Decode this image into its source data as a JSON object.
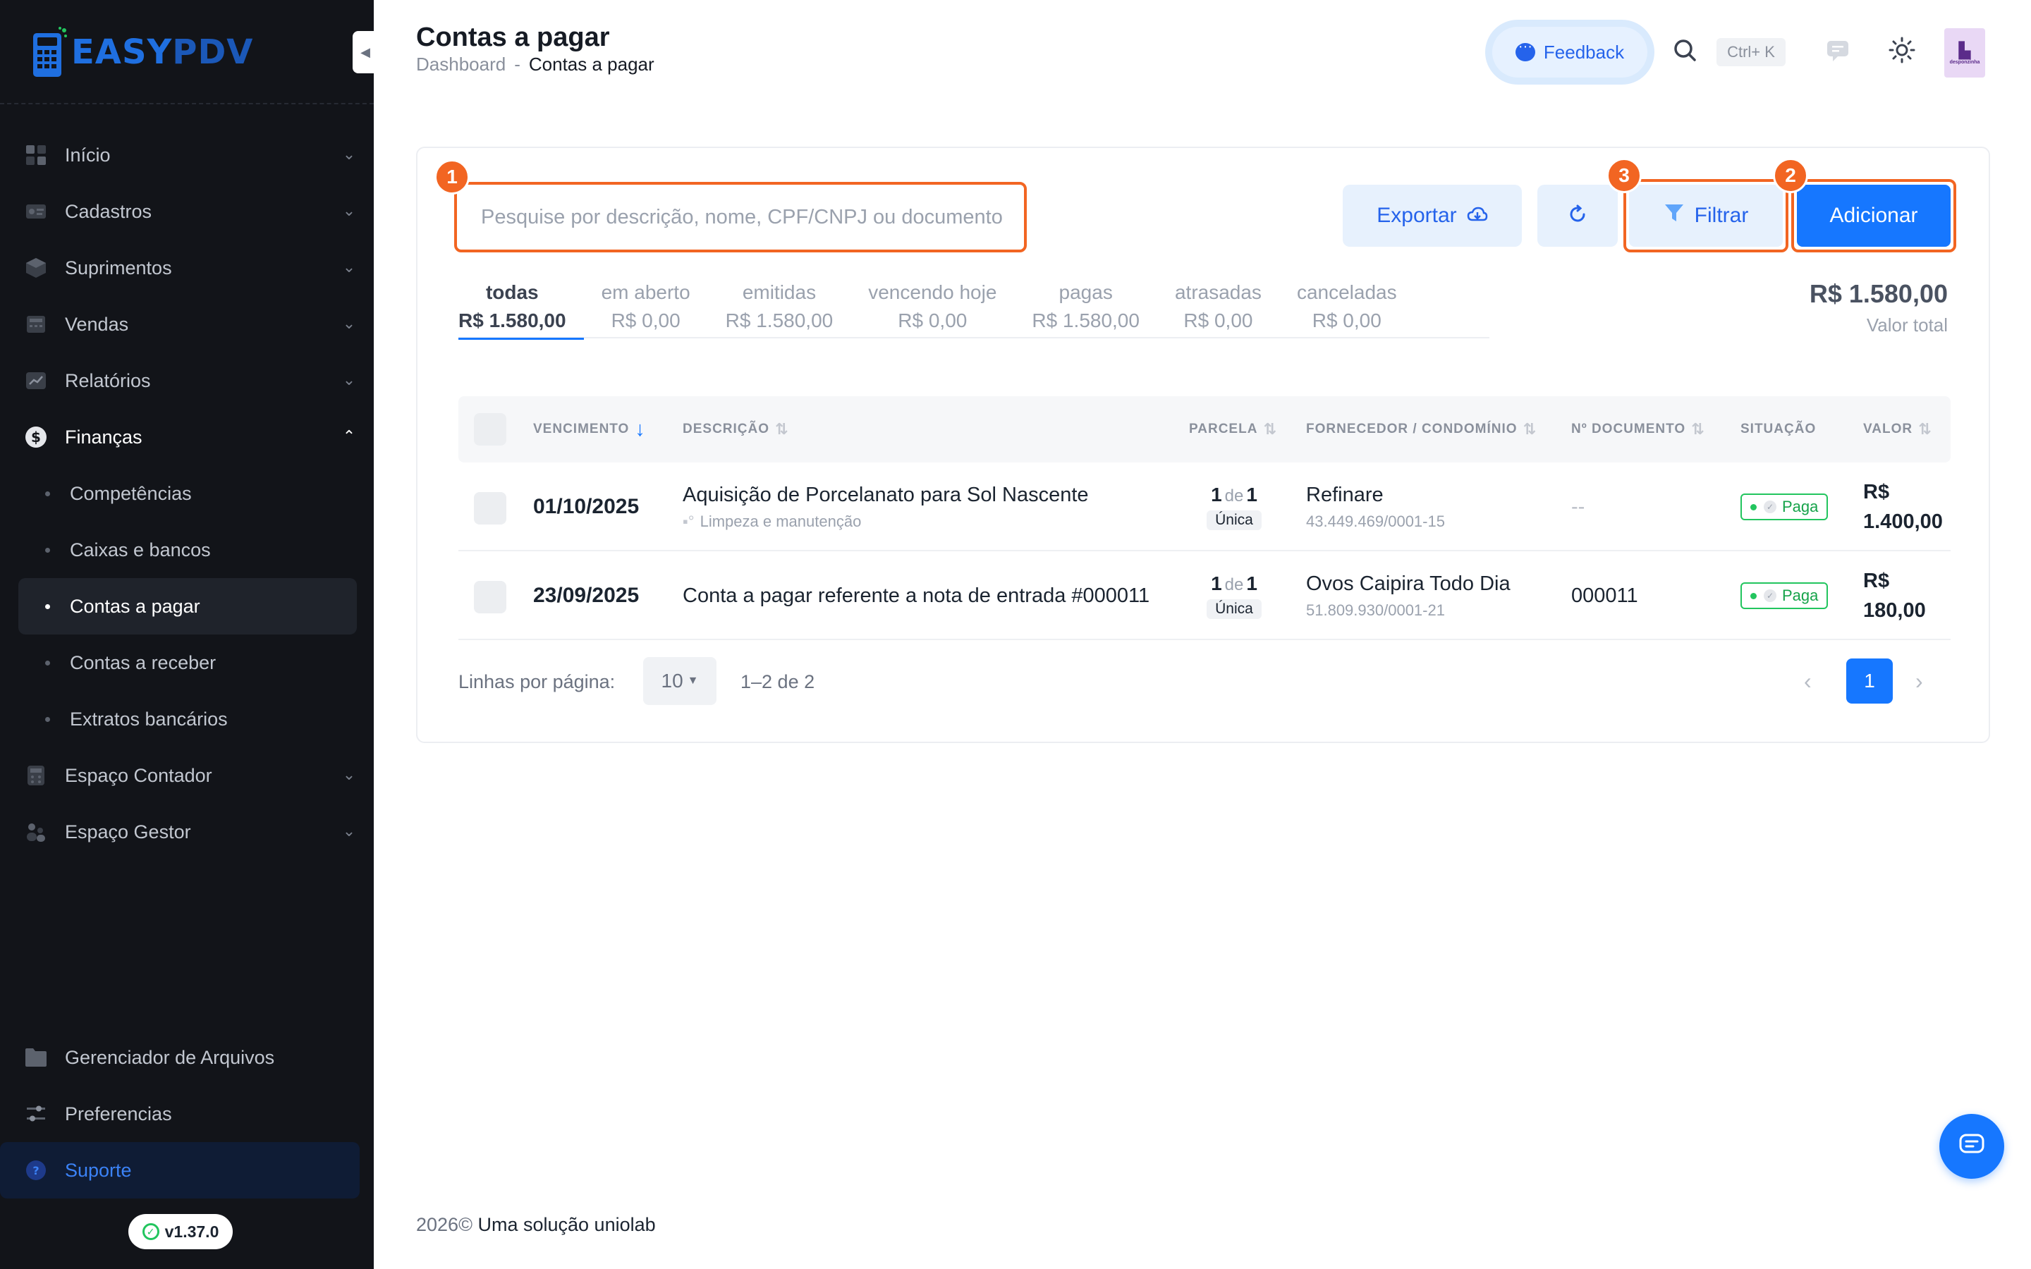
{
  "app": {
    "brand_1": "EASY",
    "brand_2": "PDV",
    "version": "v1.37.0"
  },
  "sidebar": {
    "items": [
      {
        "label": "Início",
        "icon": "home-icon"
      },
      {
        "label": "Cadastros",
        "icon": "id-card-icon"
      },
      {
        "label": "Suprimentos",
        "icon": "box-icon"
      },
      {
        "label": "Vendas",
        "icon": "register-icon"
      },
      {
        "label": "Relatórios",
        "icon": "chart-icon"
      },
      {
        "label": "Finanças",
        "icon": "dollar-icon",
        "expanded": true
      }
    ],
    "finance_sub": [
      {
        "label": "Competências"
      },
      {
        "label": "Caixas e bancos"
      },
      {
        "label": "Contas a pagar",
        "active": true
      },
      {
        "label": "Contas a receber"
      },
      {
        "label": "Extratos bancários"
      }
    ],
    "items_after": [
      {
        "label": "Espaço Contador",
        "icon": "calculator-icon"
      },
      {
        "label": "Espaço Gestor",
        "icon": "people-icon"
      }
    ],
    "bottom": [
      {
        "label": "Gerenciador de Arquivos",
        "icon": "folder-icon"
      },
      {
        "label": "Preferencias",
        "icon": "sliders-icon"
      },
      {
        "label": "Suporte",
        "icon": "help-icon",
        "active": true
      }
    ]
  },
  "header": {
    "title": "Contas a pagar",
    "breadcrumb_home": "Dashboard",
    "breadcrumb_sep": "-",
    "breadcrumb_current": "Contas a pagar",
    "feedback_label": "Feedback",
    "shortcut": "Ctrl+ K",
    "avatar_text": "desponzinha"
  },
  "toolbar": {
    "search_placeholder": "Pesquise por descrição, nome, CPF/CNPJ ou documento",
    "export_label": "Exportar",
    "filter_label": "Filtrar",
    "add_label": "Adicionar",
    "markers": [
      "1",
      "3",
      "2"
    ]
  },
  "tabs": [
    {
      "label": "todas",
      "value": "R$ 1.580,00",
      "active": true
    },
    {
      "label": "em aberto",
      "value": "R$ 0,00"
    },
    {
      "label": "emitidas",
      "value": "R$ 1.580,00"
    },
    {
      "label": "vencendo hoje",
      "value": "R$ 0,00"
    },
    {
      "label": "pagas",
      "value": "R$ 1.580,00"
    },
    {
      "label": "atrasadas",
      "value": "R$ 0,00"
    },
    {
      "label": "canceladas",
      "value": "R$ 0,00"
    }
  ],
  "total": {
    "value": "R$ 1.580,00",
    "label": "Valor total"
  },
  "table": {
    "columns": {
      "vencimento": "VENCIMENTO",
      "descricao": "DESCRIÇÃO",
      "parcela": "PARCELA",
      "fornecedor": "FORNECEDOR / CONDOMÍNIO",
      "documento": "Nº DOCUMENTO",
      "situacao": "SITUAÇÃO",
      "valor": "VALOR"
    },
    "rows": [
      {
        "vencimento": "01/10/2025",
        "descricao": "Aquisição de Porcelanato para Sol Nascente",
        "categoria": "Limpeza e manutenção",
        "parcela_n": "1",
        "parcela_de": "de",
        "parcela_total": "1",
        "parcela_tipo": "Única",
        "fornecedor": "Refinare",
        "cnpj": "43.449.469/0001-15",
        "documento": "--",
        "situacao": "Paga",
        "valor_1": "R$",
        "valor_2": "1.400,00"
      },
      {
        "vencimento": "23/09/2025",
        "descricao": "Conta a pagar referente a nota de entrada #000011",
        "categoria": "",
        "parcela_n": "1",
        "parcela_de": "de",
        "parcela_total": "1",
        "parcela_tipo": "Única",
        "fornecedor": "Ovos Caipira Todo Dia",
        "cnpj": "51.809.930/0001-21",
        "documento": "000011",
        "situacao": "Paga",
        "valor_1": "R$",
        "valor_2": "180,00"
      }
    ]
  },
  "pagination": {
    "rows_label": "Linhas por página:",
    "rows_value": "10",
    "range": "1–2 de 2",
    "current_page": "1"
  },
  "footer": {
    "year": "2026©",
    "text": "Uma solução uniolab"
  },
  "colors": {
    "accent": "#1677ff",
    "highlight": "#f26522",
    "sidebar_bg": "#121419",
    "success": "#22c55e"
  }
}
